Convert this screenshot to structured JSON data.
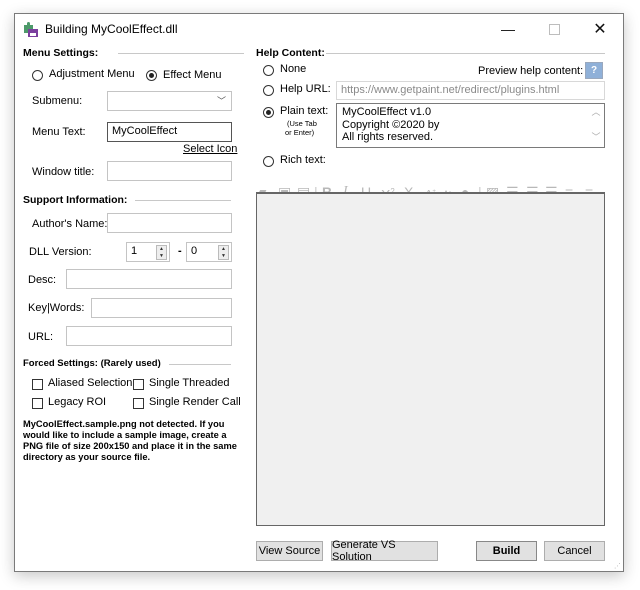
{
  "window": {
    "title": "Building MyCoolEffect.dll",
    "app_icon": "puzzle-build-icon",
    "controls": {
      "minimize": "—",
      "maximize": "",
      "close": "✕"
    }
  },
  "menu_settings": {
    "heading": "Menu Settings:",
    "menu_type_options": [
      {
        "label": "Adjustment Menu",
        "selected": false
      },
      {
        "label": "Effect Menu",
        "selected": true
      }
    ],
    "submenu_label": "Submenu:",
    "submenu_value": "",
    "menu_text_label": "Menu Text:",
    "menu_text_value": "MyCoolEffect",
    "select_icon_link": "Select Icon",
    "window_title_label": "Window title:",
    "window_title_value": ""
  },
  "support_information": {
    "heading": "Support Information:",
    "author_label": "Author's Name:",
    "author_value": "",
    "dll_version_label": "DLL Version:",
    "major_version": "1",
    "version_separator": "-",
    "minor_version": "0",
    "desc_label": "Desc:",
    "desc_value": "",
    "keywords_label": "Key|Words:",
    "keywords_value": "",
    "url_label": "URL:",
    "url_value": ""
  },
  "forced_settings": {
    "heading": "Forced Settings: (Rarely used)",
    "options": [
      {
        "label": "Aliased Selection",
        "checked": false
      },
      {
        "label": "Single Threaded",
        "checked": false
      },
      {
        "label": "Legacy ROI",
        "checked": false
      },
      {
        "label": "Single Render Call",
        "checked": false
      }
    ]
  },
  "sample_note": "MyCoolEffect.sample.png not detected.  If you would like to include a sample image, create a PNG file of size 200x150 and place it in the same directory as your source file.",
  "help_content": {
    "heading": "Help Content:",
    "options": [
      {
        "label": "None",
        "selected": false
      },
      {
        "label": "Help URL:",
        "selected": false
      },
      {
        "label": "Plain text:",
        "selected": true
      },
      {
        "label": "Rich text:",
        "selected": false
      }
    ],
    "plain_text_hint_line1": "(Use Tab",
    "plain_text_hint_line2": "or Enter)",
    "preview_label": "Preview help content:",
    "preview_button": "?",
    "help_url_value": "https://www.getpaint.net/redirect/plugins.html",
    "plain_text_lines": [
      "MyCoolEffect v1.0",
      "Copyright ©2020 by",
      "All rights reserved."
    ],
    "rich_text_toolbar": [
      "open-icon",
      "save-icon",
      "save-as-icon",
      "bold-icon",
      "italic-icon",
      "underline-icon",
      "superscript-icon",
      "subscript-icon",
      "font-grow-icon",
      "font-shrink-icon",
      "color-icon",
      "insert-image-icon",
      "bullet-list-icon",
      "indent-icon",
      "outdent-icon",
      "align-left-icon",
      "align-center-icon"
    ]
  },
  "buttons": {
    "view_source": "View Source",
    "generate_vs": "Generate VS Solution",
    "build": "Build",
    "cancel": "Cancel"
  },
  "colors": {
    "preview_button_bg": "#8fb0d8",
    "border": "#7a7a7a",
    "button_bg": "#e1e1e1"
  }
}
